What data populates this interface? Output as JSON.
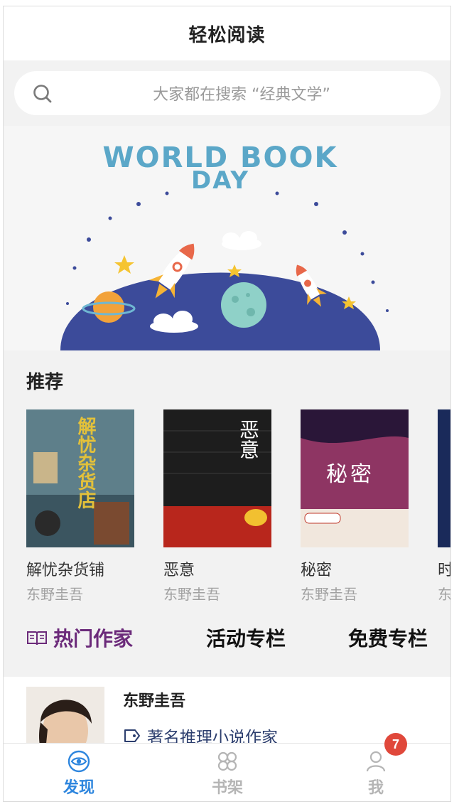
{
  "navbar": {
    "title": "轻松阅读"
  },
  "search": {
    "placeholder": "大家都在搜索 “经典文学”",
    "icon": "search-icon"
  },
  "banner": {
    "headline_line1": "WORLD BOOK",
    "headline_line2": "DAY"
  },
  "recommend": {
    "title": "推荐",
    "books": [
      {
        "name": "解忧杂货铺",
        "author": "东野圭吾",
        "cover_text": "解忧杂货店",
        "cover_color": "#6f8f99"
      },
      {
        "name": "恶意",
        "author": "东野圭吾",
        "cover_text": "恶意",
        "cover_color": "#1c1c1c"
      },
      {
        "name": "秘密",
        "author": "东野圭吾",
        "cover_text": "秘密",
        "cover_color": "#7a2c52"
      },
      {
        "name": "时",
        "author": "东",
        "cover_text": "",
        "cover_color": "#1a2a5a"
      }
    ]
  },
  "category_tabs": [
    {
      "label": "热门作家",
      "active": true,
      "icon": "book-open-icon"
    },
    {
      "label": "活动专栏",
      "active": false
    },
    {
      "label": "免费专栏",
      "active": false
    }
  ],
  "author": {
    "name": "东野圭吾",
    "tag": "著名推理小说作家",
    "tag_icon": "tag-icon"
  },
  "tabbar": {
    "items": [
      {
        "label": "发现",
        "icon": "eye-icon",
        "active": true
      },
      {
        "label": "书架",
        "icon": "bookshelf-icon",
        "active": false
      },
      {
        "label": "我",
        "icon": "user-icon",
        "active": false
      }
    ],
    "badge_count": "7"
  },
  "colors": {
    "accent_blue": "#2e86de",
    "active_tab_purple": "#6b2a7a",
    "inactive_gray": "#b5b5b5",
    "badge_red": "#e0483b"
  }
}
